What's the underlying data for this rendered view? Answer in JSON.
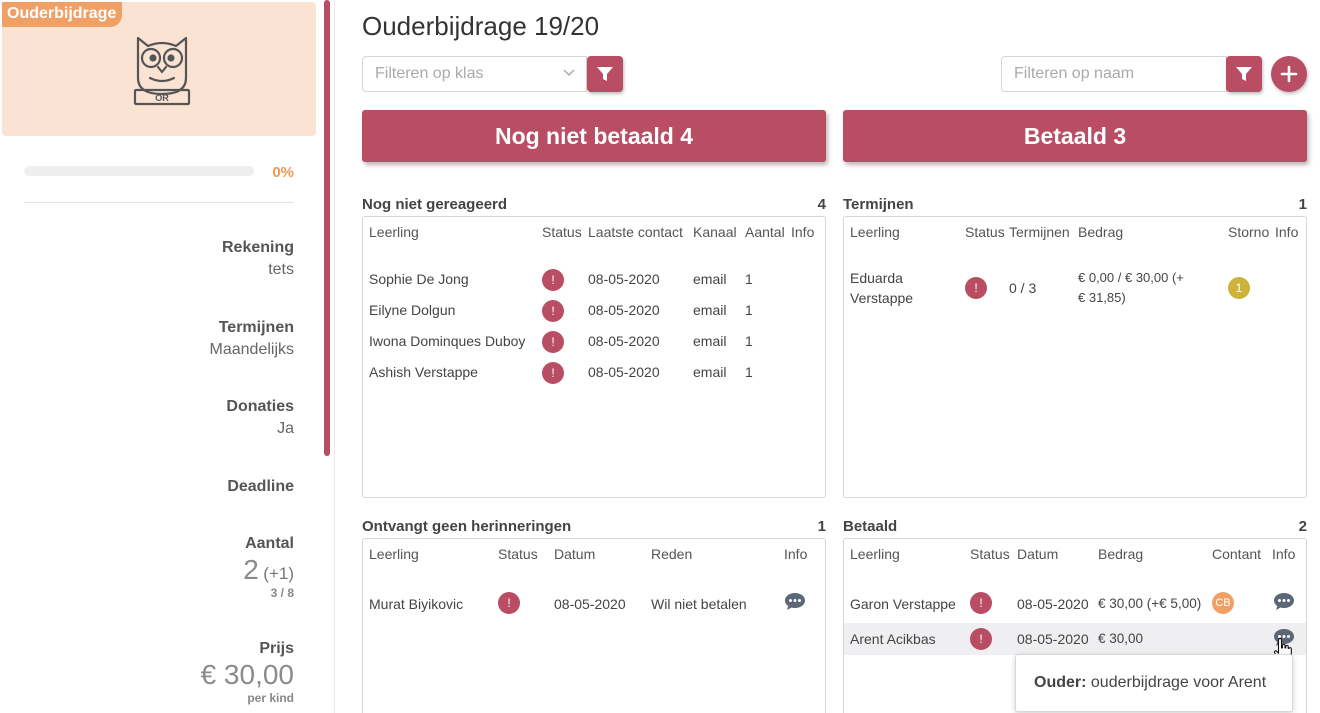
{
  "sidebar": {
    "badge": "Ouderbijdrage",
    "owl_label": "OR",
    "progress": {
      "percent_text": "0%",
      "value": 0,
      "color": "#ee9956"
    },
    "rekening": {
      "label": "Rekening",
      "value": "tets"
    },
    "termijnen": {
      "label": "Termijnen",
      "value": "Maandelijks"
    },
    "donaties": {
      "label": "Donaties",
      "value": "Ja"
    },
    "deadline": {
      "label": "Deadline"
    },
    "aantal": {
      "label": "Aantal",
      "value": "2",
      "delta": "(+1)",
      "sub": "3 / 8"
    },
    "prijs": {
      "label": "Prijs",
      "value": "€ 30,00",
      "sub": "per kind"
    }
  },
  "header": {
    "title": "Ouderbijdrage 19/20",
    "class_filter_placeholder": "Filteren op klas",
    "name_filter_placeholder": "Filteren op naam"
  },
  "tabs": {
    "unpaid": "Nog niet betaald 4",
    "paid": "Betaald 3"
  },
  "sections": {
    "not_responded": {
      "title": "Nog niet gereageerd",
      "count": "4",
      "columns": [
        "Leerling",
        "Status",
        "Laatste contact",
        "Kanaal",
        "Aantal",
        "Info"
      ],
      "rows": [
        {
          "name": "Sophie De Jong",
          "status": "!",
          "date": "08-05-2020",
          "channel": "email",
          "count": "1"
        },
        {
          "name": "Eilyne Dolgun",
          "status": "!",
          "date": "08-05-2020",
          "channel": "email",
          "count": "1"
        },
        {
          "name": "Iwona Dominques Duboy",
          "status": "!",
          "date": "08-05-2020",
          "channel": "email",
          "count": "1"
        },
        {
          "name": "Ashish Verstappe",
          "status": "!",
          "date": "08-05-2020",
          "channel": "email",
          "count": "1"
        }
      ]
    },
    "installments": {
      "title": "Termijnen",
      "count": "1",
      "columns": [
        "Leerling",
        "Status",
        "Termijnen",
        "Bedrag",
        "Storno",
        "Info"
      ],
      "rows": [
        {
          "name_line1": "Eduarda",
          "name_line2": "Verstappe",
          "status": "!",
          "termijnen": "0 / 3",
          "amount_line1": "€ 0,00 / € 30,00 (+",
          "amount_line2": "€ 31,85)",
          "storno": "1"
        }
      ]
    },
    "no_reminders": {
      "title": "Ontvangt geen herinneringen",
      "count": "1",
      "columns": [
        "Leerling",
        "Status",
        "Datum",
        "Reden",
        "Info"
      ],
      "rows": [
        {
          "name": "Murat Biyikovic",
          "status": "!",
          "date": "08-05-2020",
          "reason": "Wil niet betalen"
        }
      ]
    },
    "paid": {
      "title": "Betaald",
      "count": "2",
      "columns": [
        "Leerling",
        "Status",
        "Datum",
        "Bedrag",
        "Contant",
        "Info"
      ],
      "rows": [
        {
          "name": "Garon Verstappe",
          "status": "!",
          "date": "08-05-2020",
          "amount": "€ 30,00 (+€ 5,00)",
          "cash": "CB"
        },
        {
          "name": "Arent Acikbas",
          "status": "!",
          "date": "08-05-2020",
          "amount": "€ 30,00",
          "cash": ""
        }
      ]
    }
  },
  "tooltip": {
    "label": "Ouder:",
    "text": "ouderbijdrage voor Arent"
  },
  "colors": {
    "accent": "#b94d64",
    "orange": "#f0a065",
    "card_bg": "#fbe3d3",
    "storno_badge": "#cdb33a",
    "chat_icon": "#5b6677"
  },
  "icons": [
    "owl-icon",
    "filter-icon",
    "plus-icon",
    "chevron-down-icon",
    "chat-icon",
    "hand-cursor-icon"
  ]
}
